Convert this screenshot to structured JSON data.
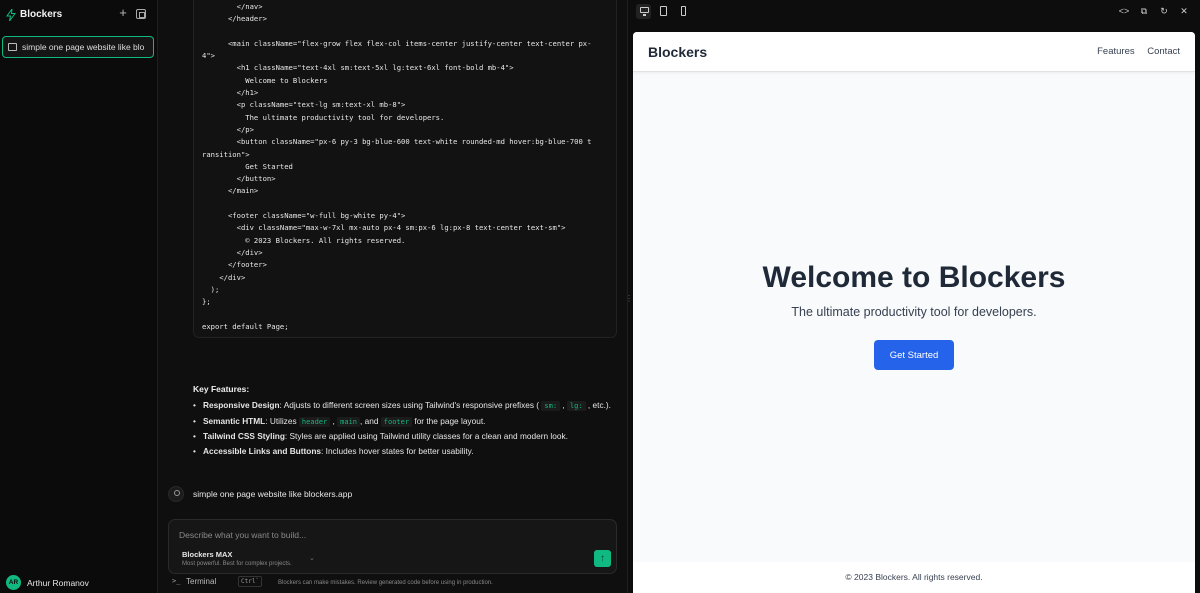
{
  "sidebar": {
    "title": "Blockers",
    "chats": [
      {
        "label": "simple one page website like blo"
      }
    ],
    "user": {
      "initials": "AR",
      "name": "Arthur Romanov"
    }
  },
  "chat": {
    "code_lines": [
      "        </nav>",
      "      </header>",
      "",
      "      <main className=\"flex-grow flex flex-col items-center justify-center text-center px-",
      "4\">",
      "        <h1 className=\"text-4xl sm:text-5xl lg:text-6xl font-bold mb-4\">",
      "          Welcome to Blockers",
      "        </h1>",
      "        <p className=\"text-lg sm:text-xl mb-8\">",
      "          The ultimate productivity tool for developers.",
      "        </p>",
      "        <button className=\"px-6 py-3 bg-blue-600 text-white rounded-md hover:bg-blue-700 t",
      "ransition\">",
      "          Get Started",
      "        </button>",
      "      </main>",
      "",
      "      <footer className=\"w-full bg-white py-4\">",
      "        <div className=\"max-w-7xl mx-auto px-4 sm:px-6 lg:px-8 text-center text-sm\">",
      "          © 2023 Blockers. All rights reserved.",
      "        </div>",
      "      </footer>",
      "    </div>",
      "  );",
      "};",
      "",
      "export default Page;"
    ],
    "features_title": "Key Features:",
    "features": {
      "f1_bold": "Responsive Design",
      "f1_pre": ": Adjusts to different screen sizes using Tailwind's responsive prefixes (",
      "f1_tag1": "sm:",
      "f1_tag2": "lg:",
      "f1_post": "etc.).",
      "f2_bold": "Semantic HTML",
      "f2_pre": ": Utilizes",
      "f2_tag1": "header",
      "f2_tag2": "main",
      "f2_and": ", and",
      "f2_tag3": "footer",
      "f2_post": "for the page layout.",
      "f3_bold": "Tailwind CSS Styling",
      "f3_text": ": Styles are applied using Tailwind utility classes for a clean and modern look.",
      "f4_bold": "Accessible Links and Buttons",
      "f4_text": ": Includes hover states for better usability."
    },
    "user_message": "simple one page website like blockers.app",
    "composer": {
      "placeholder": "Describe what you want to build...",
      "model_name": "Blockers MAX",
      "model_desc": "Most powerful. Best for complex projects."
    },
    "terminal_label": "Terminal",
    "terminal_shortcut": "Ctrl`",
    "disclaimer": "Blockers can make mistakes. Review generated code before using in production."
  },
  "preview": {
    "brand": "Blockers",
    "nav": [
      "Features",
      "Contact"
    ],
    "hero_title": "Welcome to Blockers",
    "hero_subtitle": "The ultimate productivity tool for developers.",
    "cta_label": "Get Started",
    "footer_text": "© 2023 Blockers. All rights reserved.",
    "colors": {
      "cta": "#2563eb",
      "heading": "#1f2937",
      "accent": "#10b981"
    }
  },
  "icons": {
    "logo": "bolt-icon",
    "new_chat": "plus-icon",
    "panel": "panel-toggle-icon",
    "code": "code-icon",
    "split": "split-view-icon",
    "refresh": "refresh-icon",
    "close": "close-icon"
  }
}
